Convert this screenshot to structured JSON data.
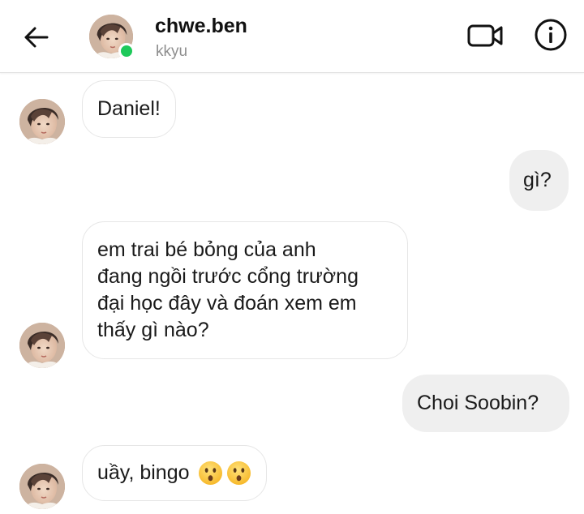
{
  "header": {
    "username": "chwe.ben",
    "subtitle": "kkyu",
    "back_icon": "arrow-left-icon",
    "video_icon": "video-camera-icon",
    "info_icon": "info-icon",
    "online_color": "#1ec95a"
  },
  "messages": [
    {
      "sender": "other",
      "text": "Daniel!"
    },
    {
      "sender": "me",
      "text": "gì?"
    },
    {
      "sender": "other",
      "lines": [
        "em trai bé bỏng của anh",
        "đang ngồi trước cổng trường",
        "đại học đây và đoán xem em",
        "thấy gì nào?"
      ]
    },
    {
      "sender": "me",
      "text": "Choi Soobin?"
    },
    {
      "sender": "other",
      "text": "uầy, bingo",
      "emojis": [
        "hushed-face-icon",
        "hushed-face-icon"
      ]
    }
  ],
  "colors": {
    "incoming_bubble": "#ffffff",
    "outgoing_bubble": "#efefef",
    "subtitle": "#8e8e8e"
  }
}
